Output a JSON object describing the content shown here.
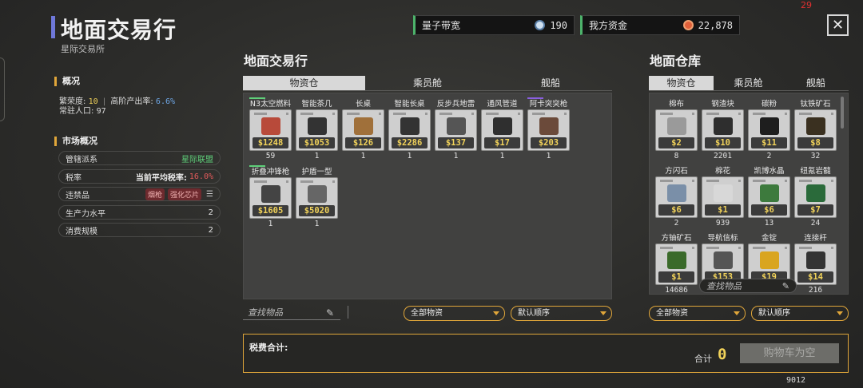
{
  "header": {
    "title": "地面交易行",
    "subtitle": "星际交易所",
    "fps": "29",
    "bandwidth_label": "量子带宽",
    "bandwidth_value": "190",
    "funds_label": "我方资金",
    "funds_value": "22,878"
  },
  "overview": {
    "title": "概况",
    "prosperity_label": "繁荣度:",
    "prosperity_value": "10",
    "sep": "|",
    "highrate_label": "高阶产出率:",
    "highrate_value": "6.6%",
    "population_label": "常驻人口:",
    "population_value": "97"
  },
  "market": {
    "title": "市场概况",
    "rows": [
      {
        "label": "管辖派系",
        "value": "星际联盟"
      },
      {
        "label": "税率",
        "value_label": "当前平均税率:",
        "value": "16.0%"
      },
      {
        "label": "违禁品",
        "tags": [
          "烟枪",
          "强化芯片"
        ],
        "menu": "☰"
      },
      {
        "label": "生产力水平",
        "value": "2"
      },
      {
        "label": "消费规模",
        "value": "2"
      }
    ]
  },
  "trade_panel": {
    "title": "地面交易行",
    "tabs": [
      "物资仓",
      "乘员舱",
      "舰船"
    ],
    "items": [
      {
        "name": "N3太空燃料",
        "price": "$1248",
        "count": "59",
        "color": "#b84a3a"
      },
      {
        "name": "智能茶几",
        "price": "$1053",
        "count": "1",
        "color": "#333333"
      },
      {
        "name": "长桌",
        "price": "$126",
        "count": "1",
        "color": "#a0703a"
      },
      {
        "name": "智能长桌",
        "price": "$2286",
        "count": "1",
        "color": "#333333"
      },
      {
        "name": "反步兵地雷",
        "price": "$137",
        "count": "1",
        "color": "#555555"
      },
      {
        "name": "通风管道",
        "price": "$17",
        "count": "1",
        "color": "#2f2f2f"
      },
      {
        "name": "阿卡突突枪",
        "price": "$203",
        "count": "1",
        "color": "#6b4a3a"
      },
      {
        "name": "折叠冲锋枪",
        "price": "$1605",
        "count": "1",
        "color": "#444444"
      },
      {
        "name": "护盾一型",
        "price": "$5020",
        "count": "1",
        "color": "#666666"
      }
    ],
    "search_placeholder": "查找物品",
    "filter": "全部物资",
    "sort": "默认顺序"
  },
  "warehouse_panel": {
    "title": "地面仓库",
    "tabs": [
      "物资仓",
      "乘员舱",
      "舰船"
    ],
    "items": [
      {
        "name": "棉布",
        "price": "$2",
        "count": "8",
        "color": "#9a9a9a"
      },
      {
        "name": "钢渣块",
        "price": "$10",
        "count": "2201",
        "color": "#2e2e2e"
      },
      {
        "name": "碳粉",
        "price": "$11",
        "count": "2",
        "color": "#1e1e1e"
      },
      {
        "name": "钛铁矿石",
        "price": "$8",
        "count": "32",
        "color": "#3a3020"
      },
      {
        "name": "方闪石",
        "price": "$6",
        "count": "2",
        "color": "#7a8fa8"
      },
      {
        "name": "棉花",
        "price": "$1",
        "count": "939",
        "color": "#d8d8d8"
      },
      {
        "name": "凯博水晶",
        "price": "$6",
        "count": "13",
        "color": "#3d7a3d"
      },
      {
        "name": "纽氪岩髓",
        "price": "$7",
        "count": "24",
        "color": "#2a6a3a"
      },
      {
        "name": "方铀矿石",
        "price": "$1",
        "count": "14686",
        "color": "#3a6a2a"
      },
      {
        "name": "导航信标",
        "price": "$153",
        "count": "",
        "color": "#555555"
      },
      {
        "name": "金锭",
        "price": "$19",
        "count": "",
        "color": "#d9a520"
      },
      {
        "name": "连接杆",
        "price": "$14",
        "count": "216",
        "color": "#333333"
      }
    ],
    "search_placeholder": "查找物品",
    "filter": "全部物资",
    "sort": "默认顺序"
  },
  "footer": {
    "tax_label": "税费合计:",
    "total_label": "合计",
    "total_value": "0",
    "cart_button": "购物车为空",
    "code": "9012"
  },
  "colors": {
    "accent": "#e0a63a",
    "title_bar": "#6f78d9",
    "price": "#f2d35a",
    "green": "#5fd07a",
    "red": "#e05a5a"
  }
}
